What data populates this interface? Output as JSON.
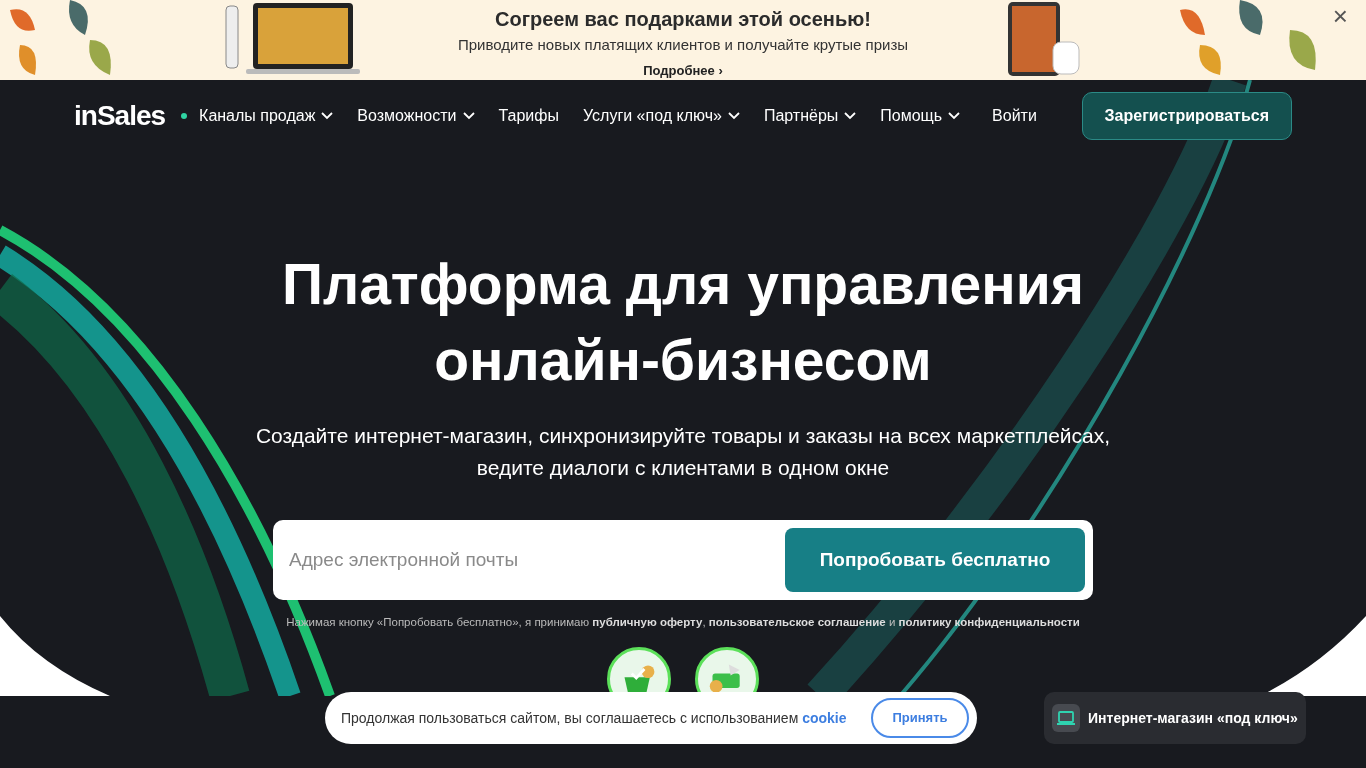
{
  "promo_banner": {
    "title": "Согреем вас подарками этой осенью!",
    "subtitle": "Приводите новых платящих клиентов и получайте крутые призы",
    "link": "Подробнее",
    "link_arrow": "›",
    "close": "×"
  },
  "navbar": {
    "logo": "inSales",
    "items": [
      {
        "label": "Каналы продаж",
        "dropdown": true,
        "dot": true
      },
      {
        "label": "Возможности",
        "dropdown": true,
        "dot": false
      },
      {
        "label": "Тарифы",
        "dropdown": false,
        "dot": false
      },
      {
        "label": "Услуги «под ключ»",
        "dropdown": true,
        "dot": false
      },
      {
        "label": "Партнёры",
        "dropdown": true,
        "dot": false
      },
      {
        "label": "Помощь",
        "dropdown": true,
        "dot": false
      }
    ],
    "login": "Войти",
    "register": "Зарегистрироваться"
  },
  "hero": {
    "title_lines": [
      "Платформа для управления",
      "онлайн-бизнесом"
    ],
    "subtitle_lines": [
      "Создайте интернет-магазин, синхронизируйте товары и заказы на всех маркетплейсах,",
      "ведите диалоги с клиентами в одном окне"
    ],
    "email_field": {
      "placeholder": "Адрес электронной почты"
    },
    "cta": "Попробовать бесплатно",
    "legal": [
      {
        "text": "Нажимая кнопку «Попробовать бесплатно», я принимаю ",
        "link": false
      },
      {
        "text": "публичную оферту",
        "link": true
      },
      {
        "text": ", ",
        "link": false
      },
      {
        "text": "пользовательское соглашение",
        "link": true
      },
      {
        "text": " и ",
        "link": false
      },
      {
        "text": "политику конфиденциальности",
        "link": true
      }
    ]
  },
  "cookie_bar": {
    "text": "Продолжая пользоваться сайтом, вы соглашаетесь с использованием ",
    "link": "cookie",
    "accept": "Принять"
  },
  "chat_widget": {
    "label": "Интернет-магазин «под ключ»"
  }
}
